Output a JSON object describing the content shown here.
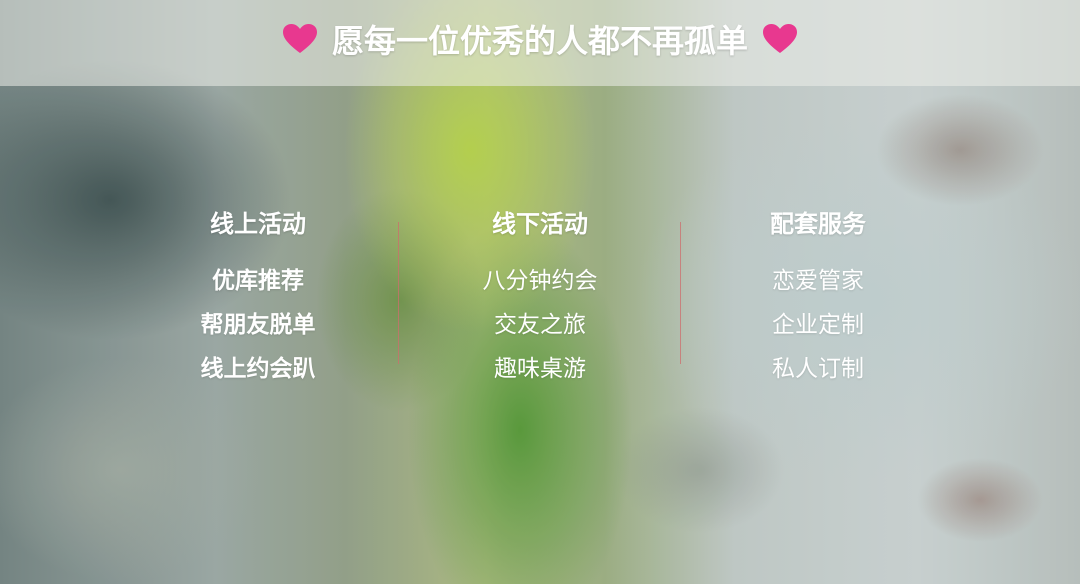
{
  "header": {
    "title": "愿每一位优秀的人都不再孤单",
    "heart_color": "#e8388f"
  },
  "columns": [
    {
      "title": "线上活动",
      "items": [
        "优库推荐",
        "帮朋友脱单",
        "线上约会趴"
      ]
    },
    {
      "title": "线下活动",
      "items": [
        "八分钟约会",
        "交友之旅",
        "趣味桌游"
      ]
    },
    {
      "title": "配套服务",
      "items": [
        "恋爱管家",
        "企业定制",
        "私人订制"
      ]
    }
  ],
  "colors": {
    "text": "#ffffff",
    "divider": "#cd6e6e"
  }
}
